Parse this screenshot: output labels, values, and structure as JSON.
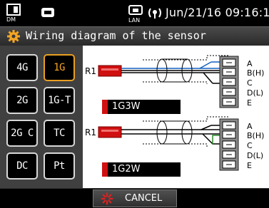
{
  "status": {
    "datetime": "Jun/21/16 09:16:12",
    "dm_label": "DM",
    "lan_label": "LAN"
  },
  "title": "Wiring diagram of the sensor",
  "sensor_buttons": [
    {
      "label": "4G",
      "selected": false
    },
    {
      "label": "1G",
      "selected": true
    },
    {
      "label": "2G",
      "selected": false
    },
    {
      "label": "1G-T",
      "selected": false
    },
    {
      "label": "2G C",
      "selected": false
    },
    {
      "label": "TC",
      "selected": false
    },
    {
      "label": "DC",
      "selected": false
    },
    {
      "label": "Pt",
      "selected": false
    }
  ],
  "diagram": {
    "top": {
      "resistor": "R1",
      "mode": "1G3W",
      "terminals": [
        "A",
        "B(H)",
        "C",
        "D(L)",
        "E"
      ]
    },
    "bottom": {
      "resistor": "R1",
      "mode": "1G2W",
      "terminals": [
        "A",
        "B(H)",
        "C",
        "D(L)",
        "E"
      ]
    }
  },
  "cancel_label": "CANCEL",
  "colors": {
    "accent": "#f5a623",
    "resistor": "#d01010",
    "wire_blue": "#1060c0",
    "jumper": "#2a8a2a"
  }
}
